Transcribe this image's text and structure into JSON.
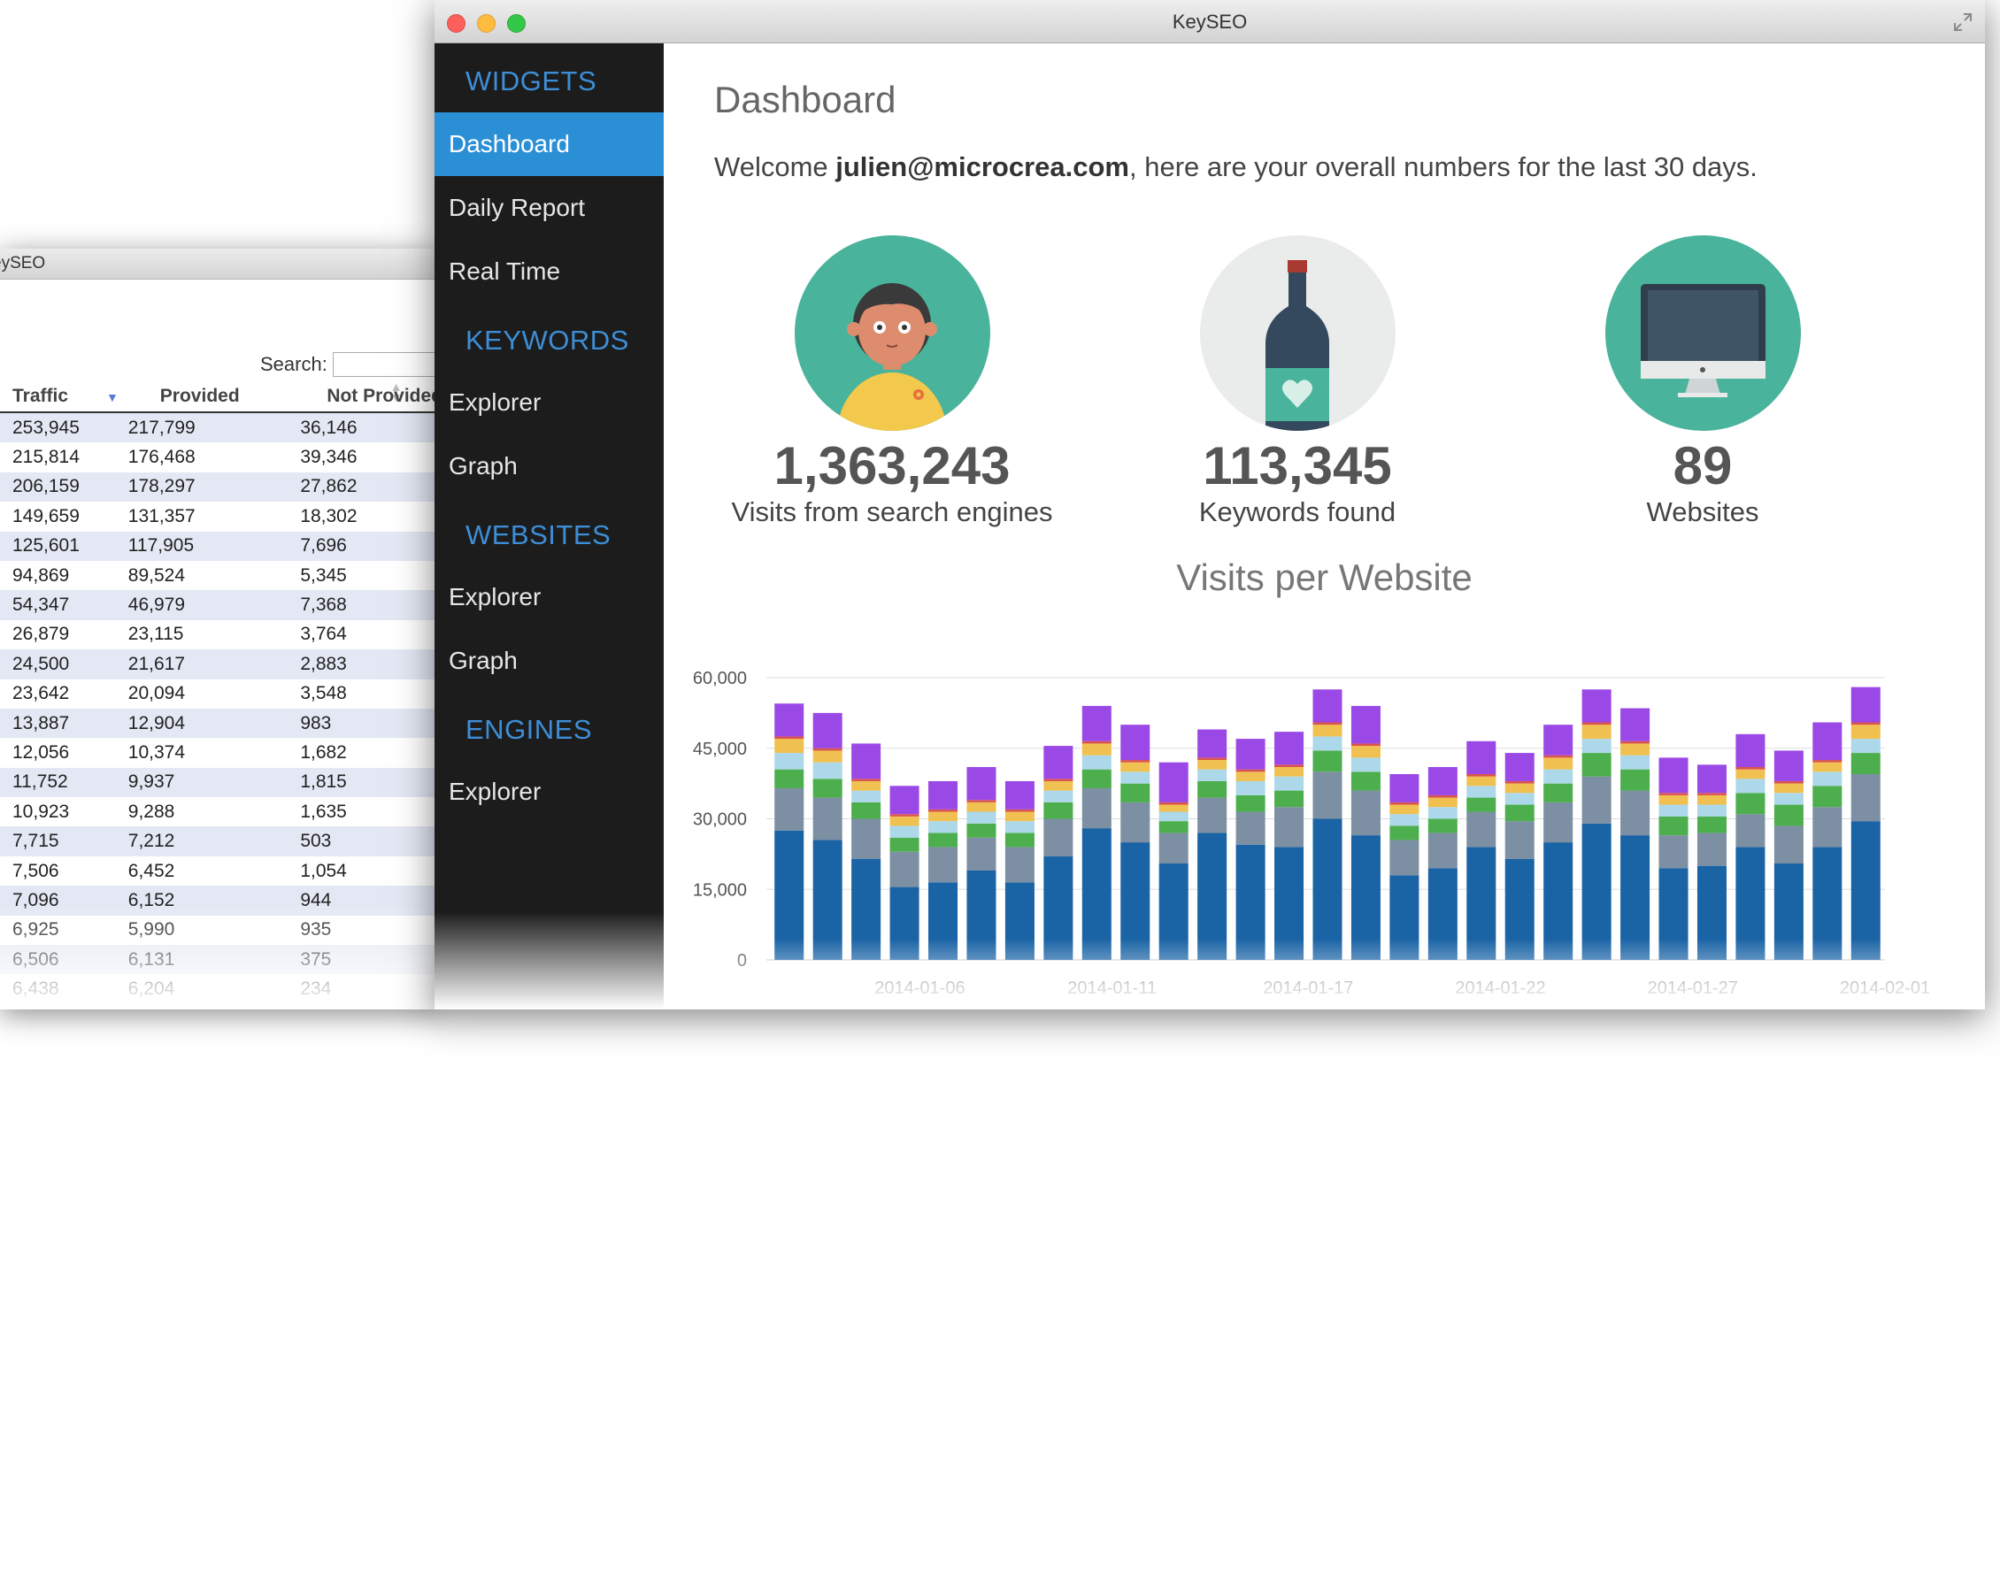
{
  "back_window": {
    "title": "eySEO",
    "search_label": "Search:",
    "columns": [
      "Traffic",
      "Provided",
      "Not Provided"
    ],
    "sort_desc_icon": "sort-desc-icon",
    "sort_icon": "sort-icon",
    "rows": [
      [
        "253,945",
        "217,799",
        "36,146"
      ],
      [
        "215,814",
        "176,468",
        "39,346"
      ],
      [
        "206,159",
        "178,297",
        "27,862"
      ],
      [
        "149,659",
        "131,357",
        "18,302"
      ],
      [
        "125,601",
        "117,905",
        "7,696"
      ],
      [
        "94,869",
        "89,524",
        "5,345"
      ],
      [
        "54,347",
        "46,979",
        "7,368"
      ],
      [
        "26,879",
        "23,115",
        "3,764"
      ],
      [
        "24,500",
        "21,617",
        "2,883"
      ],
      [
        "23,642",
        "20,094",
        "3,548"
      ],
      [
        "13,887",
        "12,904",
        "983"
      ],
      [
        "12,056",
        "10,374",
        "1,682"
      ],
      [
        "11,752",
        "9,937",
        "1,815"
      ],
      [
        "10,923",
        "9,288",
        "1,635"
      ],
      [
        "7,715",
        "7,212",
        "503"
      ],
      [
        "7,506",
        "6,452",
        "1,054"
      ],
      [
        "7,096",
        "6,152",
        "944"
      ],
      [
        "6,925",
        "5,990",
        "935"
      ],
      [
        "6,506",
        "6,131",
        "375"
      ],
      [
        "6,438",
        "6,204",
        "234"
      ]
    ]
  },
  "window": {
    "title": "KeySEO",
    "controls": [
      "close-button",
      "minimize-button",
      "zoom-button"
    ],
    "fullscreen_icon": "fullscreen-icon"
  },
  "sidebar": {
    "sections": [
      {
        "header": "WIDGETS",
        "items": [
          {
            "label": "Dashboard",
            "active": true
          },
          {
            "label": "Daily Report"
          },
          {
            "label": "Real Time"
          }
        ]
      },
      {
        "header": "KEYWORDS",
        "items": [
          {
            "label": "Explorer"
          },
          {
            "label": "Graph"
          }
        ]
      },
      {
        "header": "WEBSITES",
        "items": [
          {
            "label": "Explorer"
          },
          {
            "label": "Graph"
          }
        ]
      },
      {
        "header": "ENGINES",
        "items": [
          {
            "label": "Explorer"
          }
        ]
      }
    ]
  },
  "main": {
    "title": "Dashboard",
    "welcome_prefix": "Welcome ",
    "welcome_user": "julien@microcrea.com",
    "welcome_suffix": ", here are your overall numbers for the last 30 days.",
    "stats": [
      {
        "value": "1,363,243",
        "label": "Visits from search engines",
        "icon": "person-icon",
        "color": "#4ab39b"
      },
      {
        "value": "113,345",
        "label": "Keywords found",
        "icon": "bottle-icon",
        "color": "#eaecec"
      },
      {
        "value": "89",
        "label": "Websites",
        "icon": "monitor-icon",
        "color": "#4ab39b"
      }
    ]
  },
  "chart_data": {
    "type": "bar",
    "title": "Visits per Website",
    "stacked": true,
    "ylim": [
      0,
      60000
    ],
    "yticks": [
      "0",
      "15,000",
      "30,000",
      "45,000",
      "60,000"
    ],
    "xtick_labels": [
      "2014-01-06",
      "2014-01-11",
      "2014-01-17",
      "2014-01-22",
      "2014-01-27",
      "2014-02-01"
    ],
    "grid": true,
    "colors": [
      "#1a63a5",
      "#7d8fa3",
      "#4cae4c",
      "#add8ea",
      "#f0c050",
      "#d9534f",
      "#9b49e6"
    ],
    "totals": [
      54500,
      52500,
      46000,
      37000,
      38000,
      41000,
      38000,
      45500,
      54000,
      50000,
      42000,
      49000,
      47000,
      48500,
      57500,
      54000,
      39500,
      41000,
      46500,
      44000,
      50000,
      57500,
      53500,
      42500,
      41000,
      47500,
      44500,
      50000,
      57500
    ],
    "series": [
      {
        "values": [
          27500,
          25500,
          21500,
          15500,
          16500,
          19000,
          16500,
          22000,
          28000,
          25000,
          20500,
          27000,
          24500,
          24000,
          30000,
          26500,
          18000,
          19500,
          24000,
          21500,
          25000,
          29000,
          26500,
          19500,
          20000,
          24000,
          20500,
          24000,
          29500
        ]
      },
      {
        "values": [
          9000,
          9000,
          8500,
          7500,
          7500,
          7000,
          7500,
          8000,
          8500,
          8500,
          6500,
          7500,
          7000,
          8500,
          10000,
          9500,
          7500,
          7500,
          7500,
          8000,
          8500,
          10000,
          9500,
          7000,
          7000,
          7000,
          8000,
          8500,
          10000
        ]
      },
      {
        "values": [
          4000,
          4000,
          3500,
          3000,
          3000,
          3000,
          3000,
          3500,
          4000,
          4000,
          2500,
          3500,
          3500,
          3500,
          4500,
          4000,
          3000,
          3000,
          3000,
          3500,
          4000,
          5000,
          4500,
          4000,
          3500,
          4500,
          4500,
          4500,
          4500
        ]
      },
      {
        "values": [
          3500,
          3500,
          2500,
          2500,
          2500,
          2500,
          2500,
          2500,
          3000,
          2500,
          2000,
          2500,
          3000,
          3000,
          3000,
          3000,
          2500,
          2500,
          2500,
          2500,
          3000,
          3000,
          3000,
          2500,
          2500,
          3000,
          2500,
          3000,
          3000
        ]
      },
      {
        "values": [
          3000,
          2500,
          2000,
          2000,
          2000,
          2000,
          2000,
          2000,
          2500,
          2000,
          1500,
          2000,
          2000,
          2000,
          2500,
          2500,
          2000,
          2000,
          2000,
          2000,
          2500,
          3000,
          2500,
          2000,
          2000,
          2000,
          2000,
          2000,
          3000
        ]
      },
      {
        "values": [
          500,
          500,
          500,
          500,
          500,
          500,
          500,
          500,
          500,
          500,
          500,
          500,
          500,
          500,
          500,
          500,
          500,
          500,
          500,
          500,
          500,
          500,
          500,
          500,
          500,
          500,
          500,
          500,
          500
        ]
      },
      {
        "values": [
          7000,
          7500,
          7500,
          6000,
          6000,
          7000,
          6000,
          7000,
          7500,
          7500,
          8500,
          6000,
          6500,
          7000,
          7000,
          8000,
          6000,
          6000,
          7000,
          6000,
          6500,
          7000,
          7000,
          7500,
          6000,
          7000,
          6500,
          8000,
          7500
        ]
      }
    ]
  }
}
